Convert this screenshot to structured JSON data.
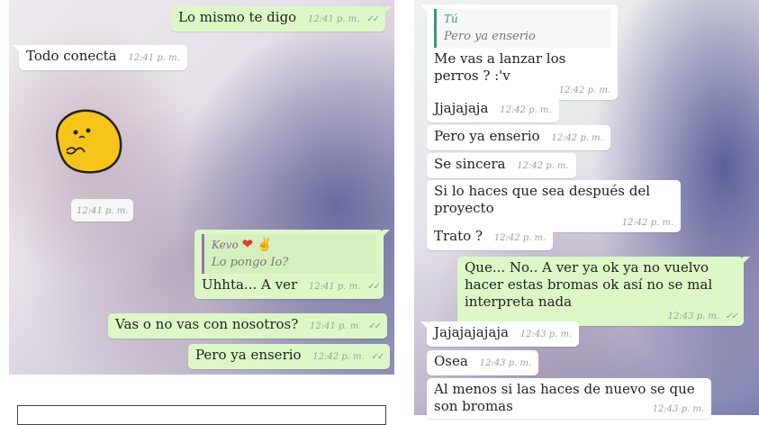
{
  "left_panel": {
    "messages": [
      {
        "text": "Lo mismo te digo",
        "time": "12:41 p. m.",
        "ticks": "✓✓"
      },
      {
        "text": "Todo conecta",
        "time": "12:41 p. m."
      },
      {
        "sticker_time": "12:41 p. m."
      },
      {
        "quote_name": "Kevo",
        "quote_emoji_1": "❤",
        "quote_emoji_2": "✌",
        "quote_text": "Lo pongo Io?",
        "text": "Uhhta... A ver",
        "time": "12:41 p. m.",
        "ticks": "✓✓"
      },
      {
        "text": "Vas o no vas con nosotros?",
        "time": "12:41 p. m.",
        "ticks": "✓✓"
      },
      {
        "text": "Pero ya enserio",
        "time": "12:42 p. m.",
        "ticks": "✓✓"
      }
    ],
    "sticker_icon": "yellow-blob-sticker-icon"
  },
  "right_panel": {
    "messages": [
      {
        "quote_name": "Tú",
        "quote_text": "Pero ya enserio",
        "text": "Me vas a lanzar los perros ? :'v",
        "time": "12:42 p. m."
      },
      {
        "text": "Jjajajaja",
        "time": "12:42 p. m."
      },
      {
        "text": "Pero ya enserio",
        "time": "12:42 p. m."
      },
      {
        "text": "Se sincera",
        "time": "12:42 p. m."
      },
      {
        "text": "Si lo haces que sea después del proyecto",
        "time": "12:42 p. m."
      },
      {
        "text": "Trato ?",
        "time": "12:42 p. m."
      },
      {
        "text": "Que... No.. A ver ya ok ya no vuelvo hacer estas bromas ok así no se mal interpreta nada",
        "time": "12:43 p. m.",
        "ticks": "✓✓"
      },
      {
        "text": "Jajajajajaja",
        "time": "12:43 p. m."
      },
      {
        "text": "Osea",
        "time": "12:43 p. m."
      },
      {
        "text": "Al menos si las haces de nuevo se que son bromas",
        "time": "12:43 p. m."
      }
    ]
  },
  "colors": {
    "outgoing_bubble": "#dcf8c6",
    "incoming_bubble": "#ffffff",
    "quote_accent": "#35987a"
  }
}
